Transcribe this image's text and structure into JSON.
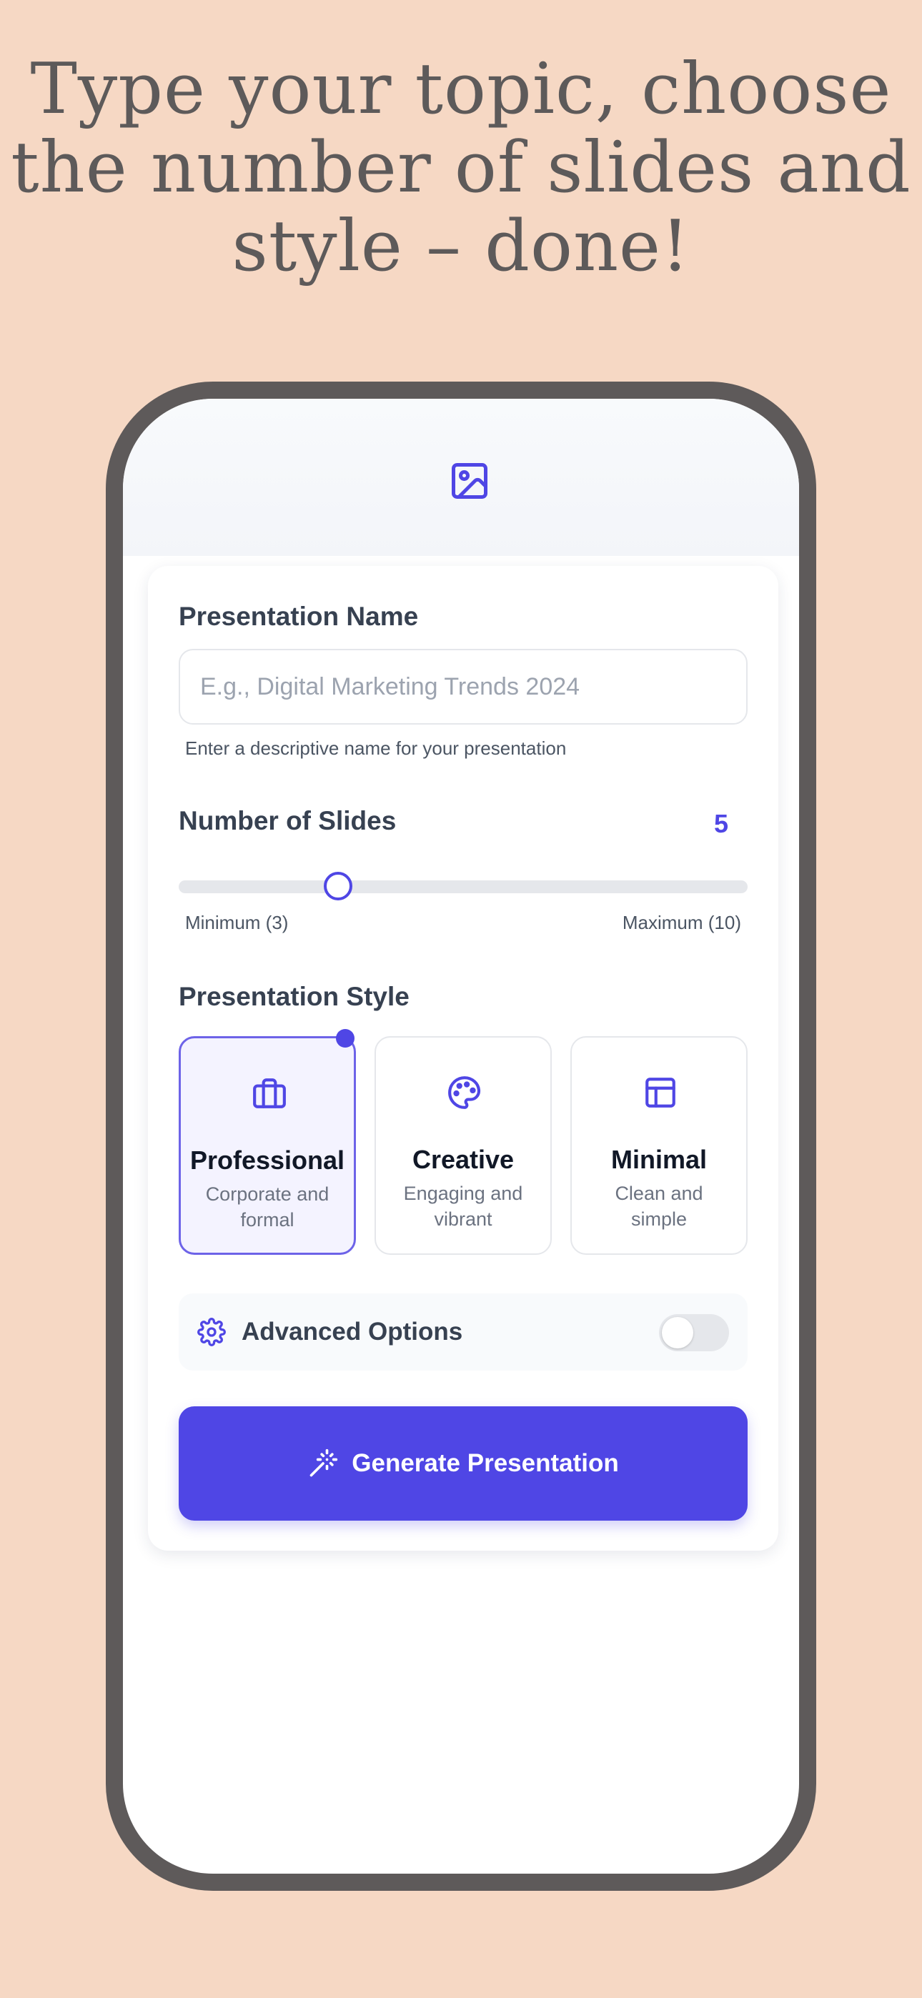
{
  "headline": {
    "line1": "Type your topic, choose",
    "line2": "the number of slides and",
    "line3": "style – done!"
  },
  "app": {
    "logo_icon": "image-icon",
    "name_field": {
      "label": "Presentation Name",
      "placeholder": "E.g., Digital Marketing Trends 2024",
      "value": "",
      "help": "Enter a descriptive name for your presentation"
    },
    "slides": {
      "label": "Number of Slides",
      "value": "5",
      "min": 3,
      "max": 10,
      "current": 5,
      "min_label": "Minimum (3)",
      "max_label": "Maximum (10)"
    },
    "style": {
      "label": "Presentation Style",
      "options": [
        {
          "title": "Professional",
          "desc": "Corporate and formal",
          "icon": "briefcase-icon",
          "selected": true
        },
        {
          "title": "Creative",
          "desc": "Engaging and vibrant",
          "icon": "palette-icon",
          "selected": false
        },
        {
          "title": "Minimal",
          "desc": "Clean and simple",
          "icon": "layout-icon",
          "selected": false
        }
      ]
    },
    "advanced": {
      "label": "Advanced Options",
      "icon": "gear-icon",
      "enabled": false
    },
    "generate_button": {
      "label": "Generate Presentation",
      "icon": "magic-wand-icon"
    },
    "colors": {
      "accent": "#4f46e5",
      "background": "#f6d8c4",
      "phone_frame": "#5e5a5a"
    }
  }
}
